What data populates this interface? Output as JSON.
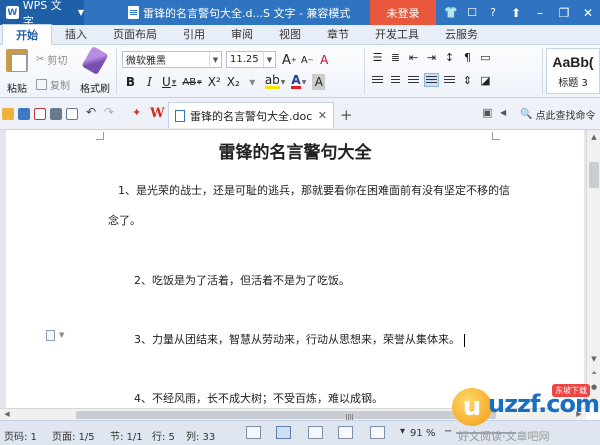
{
  "titlebar": {
    "app_name": "WPS 文字",
    "document_title": "雷锋的名言警句大全.d...S 文字 - 兼容模式",
    "login_label": "未登录"
  },
  "tabs": [
    "开始",
    "插入",
    "页面布局",
    "引用",
    "审阅",
    "视图",
    "章节",
    "开发工具",
    "云服务"
  ],
  "ribbon": {
    "paste_label": "粘贴",
    "cut_label": "剪切",
    "copy_label": "复制",
    "format_painter_label": "格式刷",
    "font_name": "微软雅黑",
    "font_size": "11.25",
    "style_sample": "AaBb(",
    "style_name": "标题 3",
    "format_glyphs": {
      "bold": "B",
      "italic": "I",
      "underline": "U",
      "strike": "AB",
      "superscript": "X²",
      "subscript": "X₂",
      "grow": "A",
      "shrink": "A",
      "clear": "A",
      "highlight": "ab",
      "font_color": "A",
      "char_shade": "A"
    }
  },
  "toolbar": {
    "doc_tab_label": "雷锋的名言警句大全.doc",
    "search_command_label": "点此查找命令",
    "new_tab_symbol": "+"
  },
  "document": {
    "heading": "雷锋的名言警句大全",
    "paragraphs": [
      "1、是光荣的战士，还是可耻的逃兵，那就要看你在困难面前有没有坚定不移的信",
      "念了。",
      "2、吃饭是为了活着，但活着不是为了吃饭。",
      "3、力量从团结来，智慧从劳动来，行动从思想来，荣誉从集体来。",
      "4、不经风雨，长不成大树；不受百炼，难以成钢。"
    ]
  },
  "status": {
    "page_num": "页码: 1",
    "page": "页面: 1/5",
    "section": "节: 1/1",
    "row": "行: 5",
    "col": "列: 33",
    "zoom": "91 %"
  },
  "watermark": {
    "logo_text": "uzzf.com",
    "badge": "东坡下载",
    "caption": "好文阅读·文章吧网"
  },
  "colors": {
    "titlebar": "#2f74c0",
    "login_button": "#e9583d",
    "ribbon_active_tab": "#1f5fa6"
  }
}
